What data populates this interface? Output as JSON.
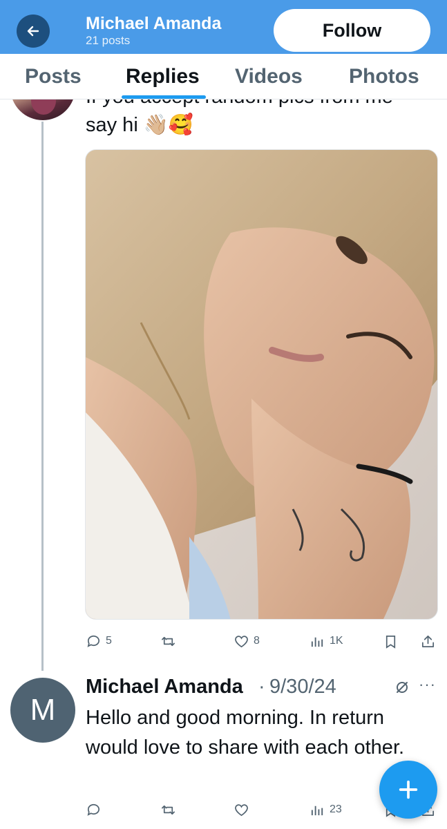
{
  "header": {
    "name": "Michael Amanda",
    "post_count": "21 posts",
    "follow_label": "Follow"
  },
  "tabs": [
    {
      "label": "Posts",
      "active": false
    },
    {
      "label": "Replies",
      "active": true
    },
    {
      "label": "Videos",
      "active": false
    },
    {
      "label": "Photos",
      "active": false
    }
  ],
  "tweet1": {
    "partial_text": "If you accept random pics from me",
    "text": "say hi 👋🏼🥰",
    "actions": {
      "replies": "5",
      "reposts": "",
      "likes": "8",
      "views": "1K"
    }
  },
  "tweet2": {
    "avatar_letter": "M",
    "author": "Michael Amanda",
    "separator": "·",
    "date": "9/30/24",
    "more": "···",
    "text": "Hello and good morning. In return would love to share with each other.",
    "actions": {
      "replies": "",
      "reposts": "",
      "likes": "",
      "views": "23"
    }
  },
  "colors": {
    "header_bg": "#4a9be8",
    "accent": "#1d9bf0",
    "muted_text": "#536471"
  },
  "icons": [
    "back-arrow-icon",
    "reply-icon",
    "repost-icon",
    "like-icon",
    "views-icon",
    "bookmark-icon",
    "share-icon",
    "mute-icon",
    "compose-plus-icon"
  ]
}
